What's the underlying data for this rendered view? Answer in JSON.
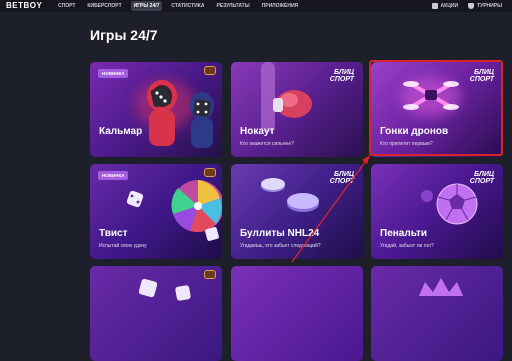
{
  "brand": {
    "logo": "BETBOY"
  },
  "nav": {
    "items": [
      "СПОРТ",
      "КИБЕРСПОРТ",
      "ИГРЫ 24/7",
      "СТАТИСТИКА",
      "РЕЗУЛЬТАТЫ",
      "ПРИЛОЖЕНИЯ"
    ],
    "active_index": 2
  },
  "topright": {
    "promotions": "АКЦИИ",
    "tournaments": "ТУРНИРЫ"
  },
  "page": {
    "title": "Игры 24/7"
  },
  "badges": {
    "new": "НОВИНКА",
    "blitz": "БЛИЦ СПОРТ"
  },
  "cards": [
    {
      "title": "Кальмар",
      "subtitle": ""
    },
    {
      "title": "Нокаут",
      "subtitle": "Кто окажется сильнее?"
    },
    {
      "title": "Гонки дронов",
      "subtitle": "Кто прилетит первым?"
    },
    {
      "title": "Твист",
      "subtitle": "Испытай свою удачу"
    },
    {
      "title": "Буллиты NHL24",
      "subtitle": "Угадаешь, кто забьет следующий?"
    },
    {
      "title": "Пенальти",
      "subtitle": "Угадай, забьют ли гол?"
    }
  ],
  "colors": {
    "accent": "#a45ce0",
    "highlight": "#d6242a",
    "background": "#1d1f2a"
  }
}
